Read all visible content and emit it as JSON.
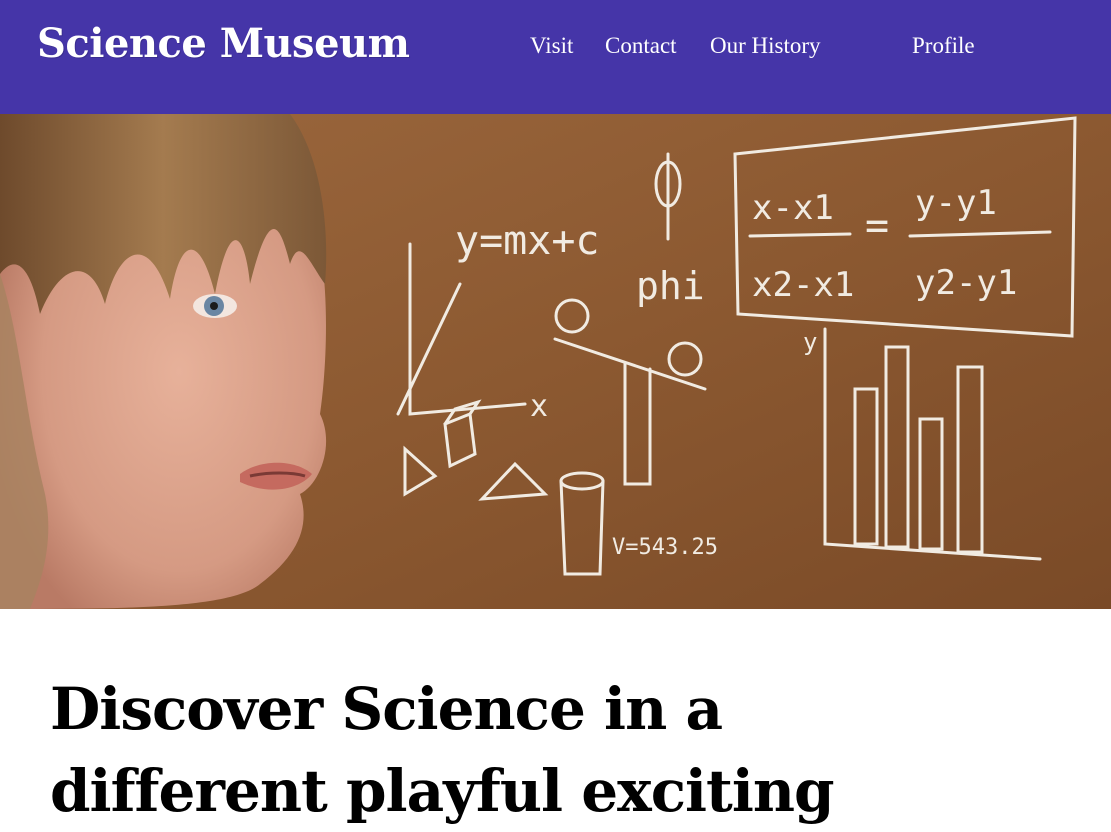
{
  "site": {
    "brand": "Science Museum"
  },
  "nav": {
    "items": [
      {
        "label": "Visit"
      },
      {
        "label": "Contact"
      },
      {
        "label": "Our History"
      },
      {
        "label": "Profile"
      }
    ]
  },
  "hero": {
    "chalk_text": {
      "equation_line": "y=mx+c",
      "phi_label": "phi",
      "volume": "V=543.25",
      "axis_x": "x",
      "axis_y": "y",
      "slope_formula_num_left": "x-x1",
      "slope_formula_den_left": "x2-x1",
      "slope_formula_num_right": "y-y1",
      "slope_formula_den_right": "y2-y1",
      "equals": "="
    }
  },
  "main": {
    "headline": "Discover Science in a different playful exciting"
  },
  "colors": {
    "nav_background": "#4535a8",
    "nav_text": "#ffffff",
    "chalk_board": "#8e5a33",
    "headline_text": "#000000"
  }
}
